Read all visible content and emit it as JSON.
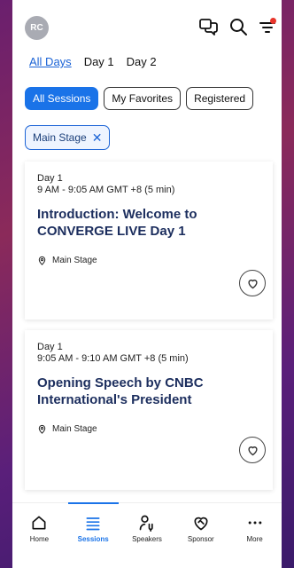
{
  "header": {
    "avatar_initials": "RC",
    "icons": [
      "chat-icon",
      "search-icon",
      "filter-icon"
    ],
    "filter_badge_color": "#e8352b"
  },
  "day_tabs": [
    "All Days",
    "Day 1",
    "Day 2"
  ],
  "session_chips": [
    "All Sessions",
    "My Favorites",
    "Registered"
  ],
  "active_filter": {
    "label": "Main Stage",
    "remove_symbol": "✕"
  },
  "sessions": [
    {
      "day": "Day 1",
      "time": "9 AM - 9:05 AM GMT +8  (5 min)",
      "title": "Introduction: Welcome to CONVERGE LIVE Day 1",
      "location": "Main Stage"
    },
    {
      "day": "Day 1",
      "time": "9:05 AM - 9:10 AM GMT +8  (5 min)",
      "title": "Opening Speech by CNBC International's President",
      "location": "Main Stage"
    }
  ],
  "bottom_nav": [
    {
      "label": "Home",
      "icon": "home-icon"
    },
    {
      "label": "Sessions",
      "icon": "list-icon"
    },
    {
      "label": "Speakers",
      "icon": "speaker-icon"
    },
    {
      "label": "Sponsor",
      "icon": "handshake-icon"
    },
    {
      "label": "More",
      "icon": "more-icon"
    }
  ],
  "colors": {
    "accent": "#1a73e8",
    "title": "#1c2e5e"
  }
}
